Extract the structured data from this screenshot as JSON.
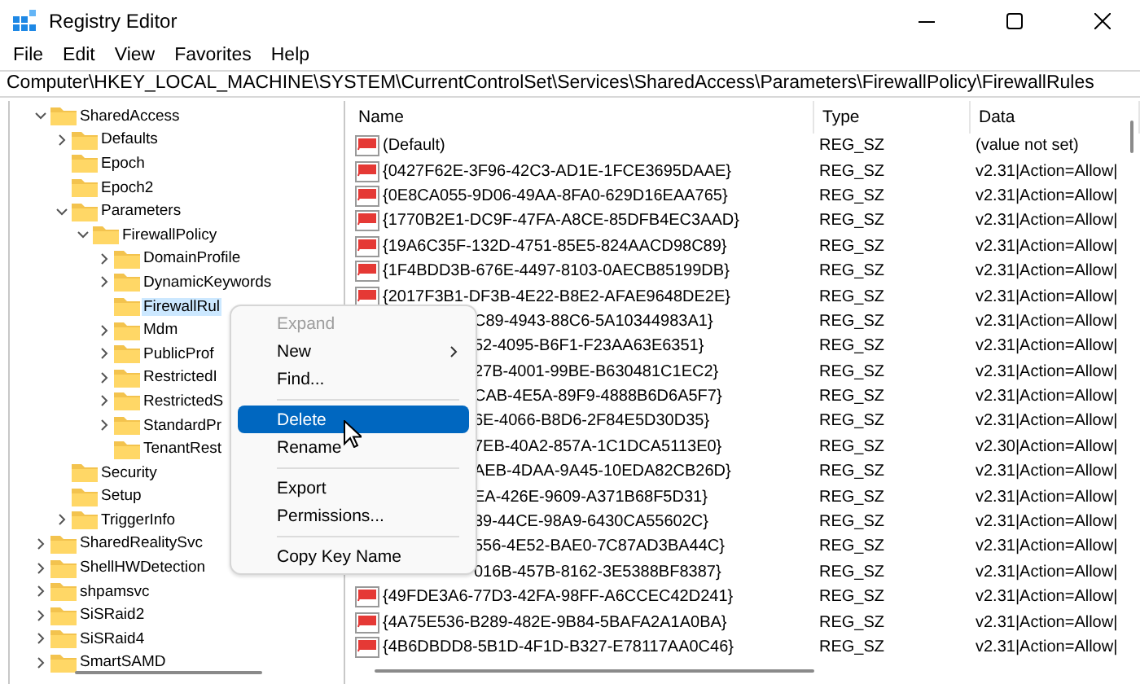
{
  "window": {
    "title": "Registry Editor"
  },
  "menu_bar": [
    "File",
    "Edit",
    "View",
    "Favorites",
    "Help"
  ],
  "address": "Computer\\HKEY_LOCAL_MACHINE\\SYSTEM\\CurrentControlSet\\Services\\SharedAccess\\Parameters\\FirewallPolicy\\FirewallRules",
  "tree": [
    {
      "label": "SharedAccess",
      "expanded": true,
      "selected": false,
      "children": [
        {
          "label": "Defaults",
          "expanded": false,
          "selected": false
        },
        {
          "label": "Epoch",
          "selected": false
        },
        {
          "label": "Epoch2",
          "selected": false
        },
        {
          "label": "Parameters",
          "expanded": true,
          "selected": false,
          "children": [
            {
              "label": "FirewallPolicy",
              "expanded": true,
              "selected": false,
              "children": [
                {
                  "label": "DomainProfile",
                  "expanded": false,
                  "selected": false
                },
                {
                  "label": "DynamicKeywords",
                  "expanded": false,
                  "selected": false
                },
                {
                  "label": "FirewallRul",
                  "selected": true
                },
                {
                  "label": "Mdm",
                  "expanded": false,
                  "selected": false
                },
                {
                  "label": "PublicProf",
                  "expanded": false,
                  "selected": false
                },
                {
                  "label": "RestrictedI",
                  "expanded": false,
                  "selected": false
                },
                {
                  "label": "RestrictedS",
                  "expanded": false,
                  "selected": false
                },
                {
                  "label": "StandardPr",
                  "expanded": false,
                  "selected": false
                },
                {
                  "label": "TenantRest",
                  "selected": false
                }
              ]
            }
          ]
        },
        {
          "label": "Security",
          "selected": false
        },
        {
          "label": "Setup",
          "selected": false
        },
        {
          "label": "TriggerInfo",
          "expanded": false,
          "selected": false
        }
      ]
    },
    {
      "label": "SharedRealitySvc",
      "expanded": false,
      "selected": false
    },
    {
      "label": "ShellHWDetection",
      "expanded": false,
      "selected": false
    },
    {
      "label": "shpamsvc",
      "expanded": false,
      "selected": false
    },
    {
      "label": "SiSRaid2",
      "expanded": false,
      "selected": false
    },
    {
      "label": "SiSRaid4",
      "expanded": false,
      "selected": false
    },
    {
      "label": "SmartSAMD",
      "expanded": false,
      "selected": false
    }
  ],
  "table": {
    "columns": [
      "Name",
      "Type",
      "Data"
    ],
    "rows": [
      {
        "name": "(Default)",
        "covered": false,
        "type": "REG_SZ",
        "data": "(value not set)"
      },
      {
        "name": "{0427F62E-3F96-42C3-AD1E-1FCE3695DAAE}",
        "covered": false,
        "type": "REG_SZ",
        "data": "v2.31|Action=Allow|"
      },
      {
        "name": "{0E8CA055-9D06-49AA-8FA0-629D16EAA765}",
        "covered": false,
        "type": "REG_SZ",
        "data": "v2.31|Action=Allow|"
      },
      {
        "name": "{1770B2E1-DC9F-47FA-A8CE-85DFB4EC3AAD}",
        "covered": false,
        "type": "REG_SZ",
        "data": "v2.31|Action=Allow|"
      },
      {
        "name": "{19A6C35F-132D-4751-85E5-824AACD98C89}",
        "covered": false,
        "type": "REG_SZ",
        "data": "v2.31|Action=Allow|"
      },
      {
        "name": "{1F4BDD3B-676E-4497-8103-0AECB85199DB}",
        "covered": false,
        "type": "REG_SZ",
        "data": "v2.31|Action=Allow|"
      },
      {
        "name": "{2017F3B1-DF3B-4E22-B8E2-AFAE9648DE2E}",
        "covered": false,
        "type": "REG_SZ",
        "data": "v2.31|Action=Allow|"
      },
      {
        "name": "C89-4943-88C6-5A10344983A1}",
        "covered": true,
        "type": "REG_SZ",
        "data": "v2.31|Action=Allow|"
      },
      {
        "name": "52-4095-B6F1-F23AA63E6351}",
        "covered": true,
        "type": "REG_SZ",
        "data": "v2.31|Action=Allow|"
      },
      {
        "name": "27B-4001-99BE-B630481C1EC2}",
        "covered": true,
        "type": "REG_SZ",
        "data": "v2.31|Action=Allow|"
      },
      {
        "name": "CAB-4E5A-89F9-4888B6D6A5F7}",
        "covered": true,
        "type": "REG_SZ",
        "data": "v2.31|Action=Allow|"
      },
      {
        "name": "6E-4066-B8D6-2F84E5D30D35}",
        "covered": true,
        "type": "REG_SZ",
        "data": "v2.31|Action=Allow|"
      },
      {
        "name": "7EB-40A2-857A-1C1DCA5113E0}",
        "covered": true,
        "type": "REG_SZ",
        "data": "v2.30|Action=Allow|"
      },
      {
        "name": "AEB-4DAA-9A45-10EDA82CB26D}",
        "covered": true,
        "type": "REG_SZ",
        "data": "v2.31|Action=Allow|"
      },
      {
        "name": "EA-426E-9609-A371B68F5D31}",
        "covered": true,
        "type": "REG_SZ",
        "data": "v2.31|Action=Allow|"
      },
      {
        "name": "39-44CE-98A9-6430CA55602C}",
        "covered": true,
        "type": "REG_SZ",
        "data": "v2.31|Action=Allow|"
      },
      {
        "name": "556-4E52-BAE0-7C87AD3BA44C}",
        "covered": true,
        "type": "REG_SZ",
        "data": "v2.31|Action=Allow|"
      },
      {
        "name": "016B-457B-8162-3E5388BF8387}",
        "covered": true,
        "type": "REG_SZ",
        "data": "v2.31|Action=Allow|"
      },
      {
        "name": "{49FDE3A6-77D3-42FA-98FF-A6CCEC42D241}",
        "covered": false,
        "type": "REG_SZ",
        "data": "v2.31|Action=Allow|"
      },
      {
        "name": "{4A75E536-B289-482E-9B84-5BAFA2A1A0BA}",
        "covered": false,
        "type": "REG_SZ",
        "data": "v2.31|Action=Allow|"
      },
      {
        "name": "{4B6DBDD8-5B1D-4F1D-B327-E78117AA0C46}",
        "covered": false,
        "type": "REG_SZ",
        "data": "v2.31|Action=Allow|"
      }
    ]
  },
  "context_menu": [
    {
      "kind": "item",
      "label": "Expand",
      "disabled": true,
      "selected": false,
      "submenu": false
    },
    {
      "kind": "item",
      "label": "New",
      "disabled": false,
      "selected": false,
      "submenu": true
    },
    {
      "kind": "item",
      "label": "Find...",
      "disabled": false,
      "selected": false,
      "submenu": false
    },
    {
      "kind": "separator"
    },
    {
      "kind": "item",
      "label": "Delete",
      "disabled": false,
      "selected": true,
      "submenu": false
    },
    {
      "kind": "item",
      "label": "Rename",
      "disabled": false,
      "selected": false,
      "submenu": false
    },
    {
      "kind": "separator"
    },
    {
      "kind": "item",
      "label": "Export",
      "disabled": false,
      "selected": false,
      "submenu": false
    },
    {
      "kind": "item",
      "label": "Permissions...",
      "disabled": false,
      "selected": false,
      "submenu": false
    },
    {
      "kind": "separator"
    },
    {
      "kind": "item",
      "label": "Copy Key Name",
      "disabled": false,
      "selected": false,
      "submenu": false
    }
  ]
}
